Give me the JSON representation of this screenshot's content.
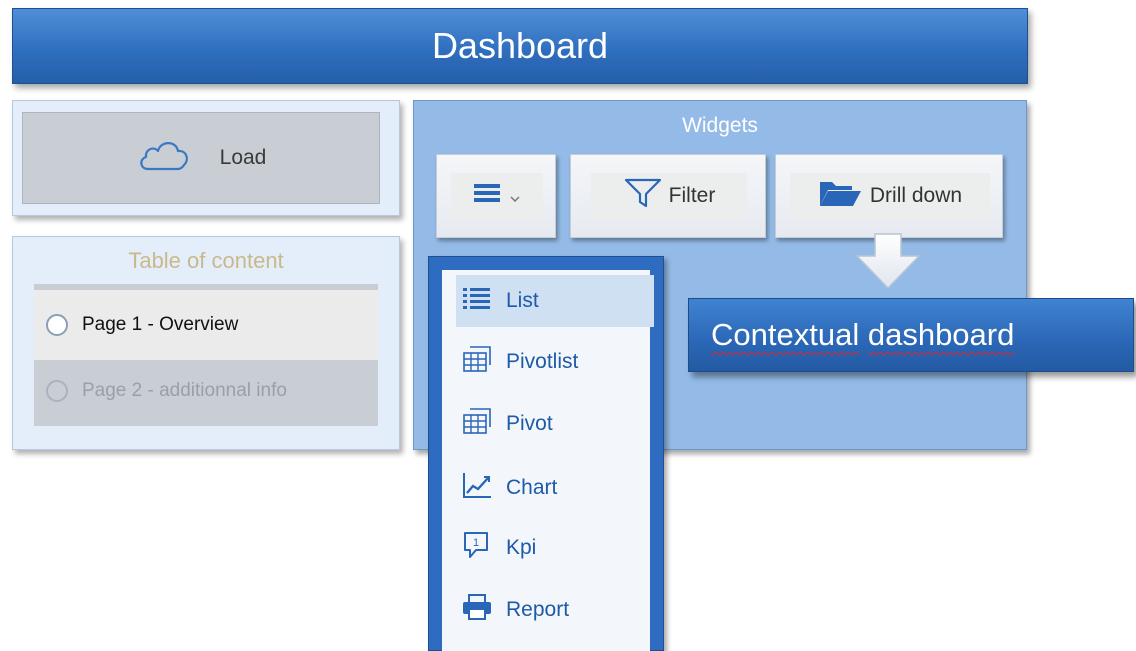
{
  "header": {
    "title": "Dashboard"
  },
  "load_panel": {
    "label": "Load",
    "icon": "cloud-icon"
  },
  "toc": {
    "title": "Table of content",
    "items": [
      {
        "label": "Page 1 - Overview",
        "state": "active"
      },
      {
        "label": "Page 2 - additionnal info",
        "state": "inactive"
      }
    ]
  },
  "widgets": {
    "title": "Widgets",
    "buttons": {
      "menu": {
        "icon": "hamburger-menu-icon"
      },
      "filter": {
        "label": "Filter",
        "icon": "funnel-icon"
      },
      "drill": {
        "label": "Drill down",
        "icon": "folder-open-icon"
      }
    }
  },
  "contextual": {
    "label_1": "Contextual",
    "label_2": "dashboard"
  },
  "dropdown": {
    "items": [
      {
        "label": "List",
        "icon": "list-icon",
        "selected": true
      },
      {
        "label": "Pivotlist",
        "icon": "pivot-table-icon"
      },
      {
        "label": "Pivot",
        "icon": "pivot-table-icon"
      },
      {
        "label": "Chart",
        "icon": "line-chart-icon"
      },
      {
        "label": "Kpi",
        "icon": "kpi-icon"
      },
      {
        "label": "Report",
        "icon": "printer-icon"
      }
    ]
  },
  "colors": {
    "primary_blue": "#2f6fbf",
    "panel_light": "#e4eefb",
    "widgets_bg": "#94bbe8",
    "menu_text": "#1e5aa8",
    "toc_title": "#c9b98a"
  }
}
